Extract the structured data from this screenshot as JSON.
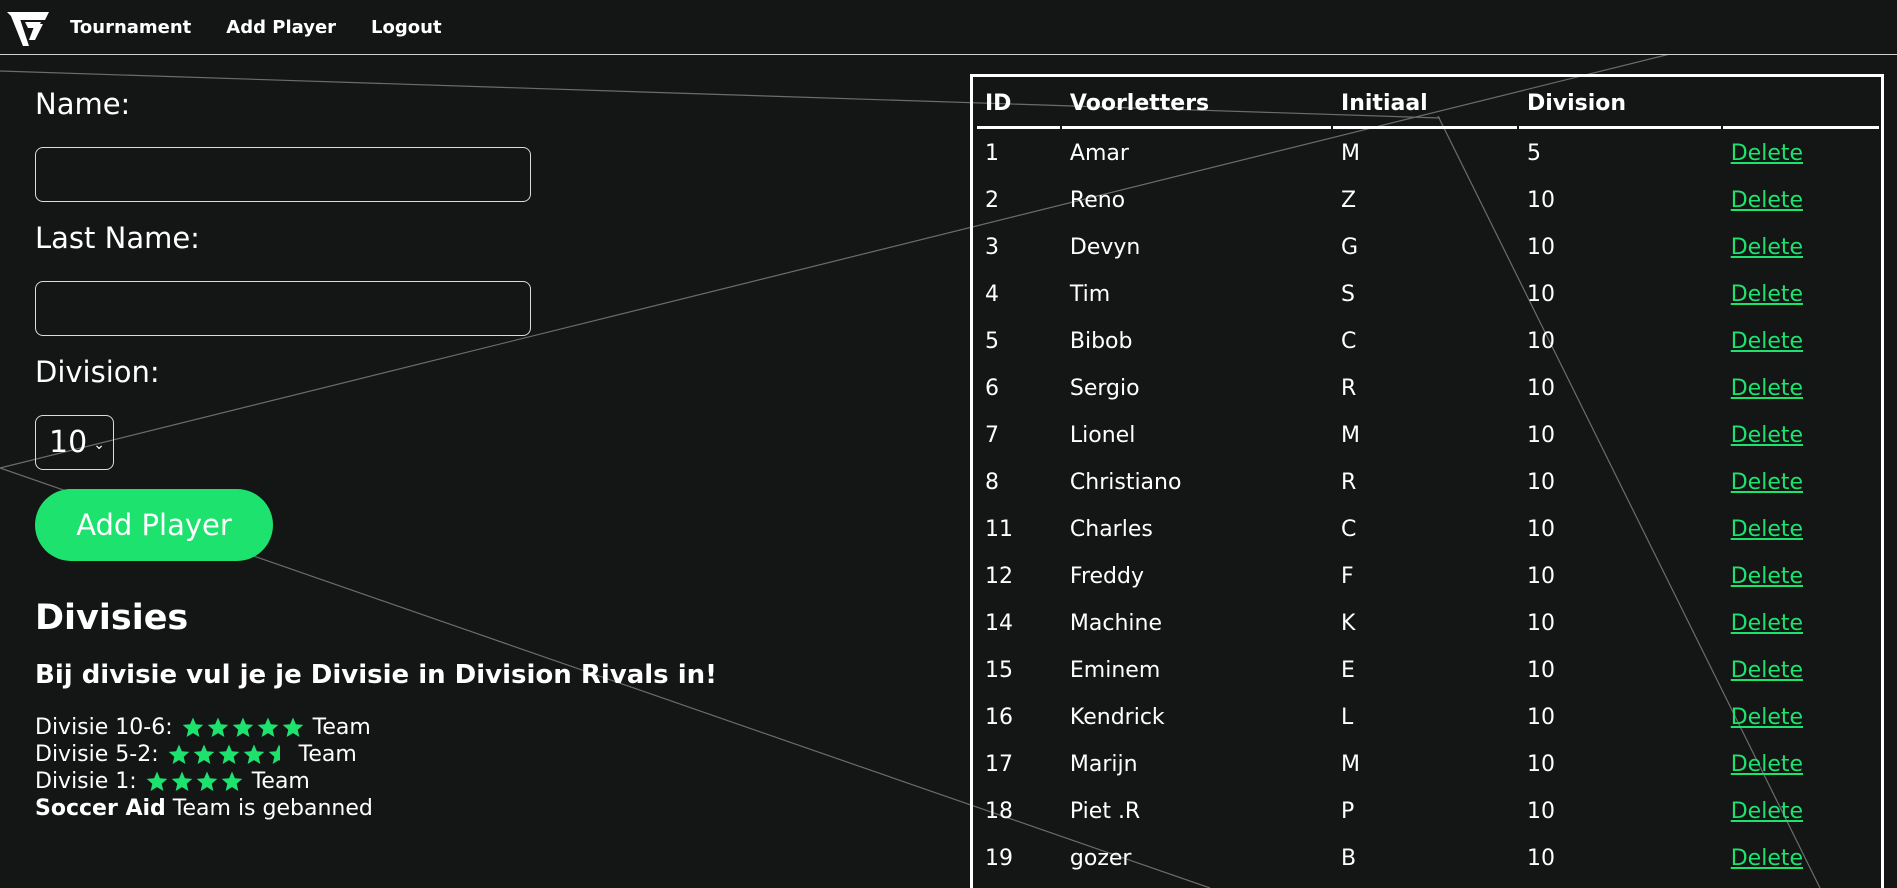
{
  "nav": {
    "logo_icon": "fc-logo-icon",
    "links": [
      "Tournament",
      "Add Player",
      "Logout"
    ]
  },
  "form": {
    "name_label": "Name:",
    "name_value": "",
    "lastname_label": "Last Name:",
    "lastname_value": "",
    "division_label": "Division:",
    "division_value": "10",
    "submit_label": "Add Player"
  },
  "divisies": {
    "title": "Divisies",
    "subtitle": "Bij divisie vul je je Divisie in Division Rivals in!",
    "lines": [
      {
        "label": "Divisie 10-6:",
        "stars": 5,
        "suffix": "Team"
      },
      {
        "label": "Divisie 5-2:",
        "stars": 4.5,
        "suffix": "Team"
      },
      {
        "label": "Divisie 1:",
        "stars": 4,
        "suffix": "Team"
      }
    ],
    "ban_bold": "Soccer Aid",
    "ban_text": "Team is gebanned"
  },
  "table": {
    "headers": [
      "ID",
      "Voorletters",
      "Initiaal",
      "Division",
      ""
    ],
    "delete_label": "Delete",
    "rows": [
      {
        "id": "1",
        "voorletters": "Amar",
        "initiaal": "M",
        "division": "5"
      },
      {
        "id": "2",
        "voorletters": "Reno",
        "initiaal": "Z",
        "division": "10"
      },
      {
        "id": "3",
        "voorletters": "Devyn",
        "initiaal": "G",
        "division": "10"
      },
      {
        "id": "4",
        "voorletters": "Tim",
        "initiaal": "S",
        "division": "10"
      },
      {
        "id": "5",
        "voorletters": "Bibob",
        "initiaal": "C",
        "division": "10"
      },
      {
        "id": "6",
        "voorletters": "Sergio",
        "initiaal": "R",
        "division": "10"
      },
      {
        "id": "7",
        "voorletters": "Lionel",
        "initiaal": "M",
        "division": "10"
      },
      {
        "id": "8",
        "voorletters": "Christiano",
        "initiaal": "R",
        "division": "10"
      },
      {
        "id": "11",
        "voorletters": "Charles",
        "initiaal": "C",
        "division": "10"
      },
      {
        "id": "12",
        "voorletters": "Freddy",
        "initiaal": "F",
        "division": "10"
      },
      {
        "id": "14",
        "voorletters": "Machine",
        "initiaal": "K",
        "division": "10"
      },
      {
        "id": "15",
        "voorletters": "Eminem",
        "initiaal": "E",
        "division": "10"
      },
      {
        "id": "16",
        "voorletters": "Kendrick",
        "initiaal": "L",
        "division": "10"
      },
      {
        "id": "17",
        "voorletters": "Marijn",
        "initiaal": "M",
        "division": "10"
      },
      {
        "id": "18",
        "voorletters": "Piet .R",
        "initiaal": "P",
        "division": "10"
      },
      {
        "id": "19",
        "voorletters": "gozer",
        "initiaal": "B",
        "division": "10"
      }
    ]
  },
  "colors": {
    "background": "#141515",
    "accent": "#1de26e",
    "text": "#ffffff"
  }
}
